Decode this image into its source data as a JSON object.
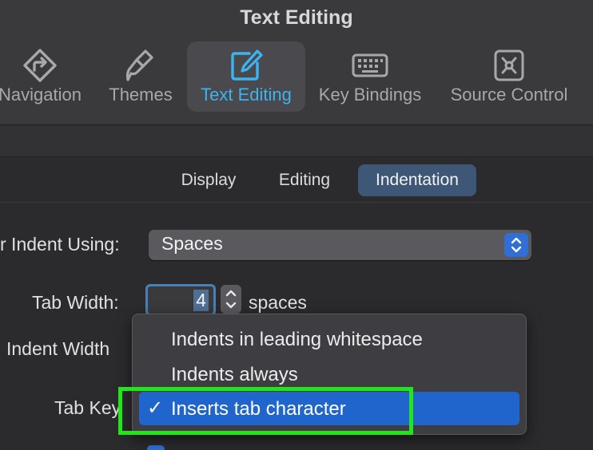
{
  "window": {
    "title": "Text Editing"
  },
  "toolbar": {
    "items": [
      {
        "label": "Navigation",
        "icon": "navigation-icon",
        "selected": false
      },
      {
        "label": "Themes",
        "icon": "brush-icon",
        "selected": false
      },
      {
        "label": "Text Editing",
        "icon": "edit-icon",
        "selected": true
      },
      {
        "label": "Key Bindings",
        "icon": "keyboard-icon",
        "selected": false
      },
      {
        "label": "Source Control",
        "icon": "source-control-icon",
        "selected": false
      }
    ],
    "selected_color": "#3cb4f0"
  },
  "tabs": {
    "items": [
      {
        "label": "Display",
        "active": false
      },
      {
        "label": "Editing",
        "active": false
      },
      {
        "label": "Indentation",
        "active": true
      }
    ],
    "active_color": "#3e5776"
  },
  "form": {
    "indent_using": {
      "label": "r Indent Using:",
      "value": "Spaces"
    },
    "tab_width": {
      "label": "Tab Width:",
      "value": "4",
      "units": "spaces"
    },
    "indent_width": {
      "label": "Indent Width"
    },
    "tab_key": {
      "label": "Tab Key"
    }
  },
  "tab_key_menu": {
    "options": [
      {
        "label": "Indents in leading whitespace",
        "selected": false
      },
      {
        "label": "Indents always",
        "selected": false
      },
      {
        "label": "Inserts tab character",
        "selected": true
      }
    ],
    "selected_color": "#1f65cc",
    "checkmark": "✓"
  },
  "annotation": {
    "highlight_color": "#22e51a"
  }
}
